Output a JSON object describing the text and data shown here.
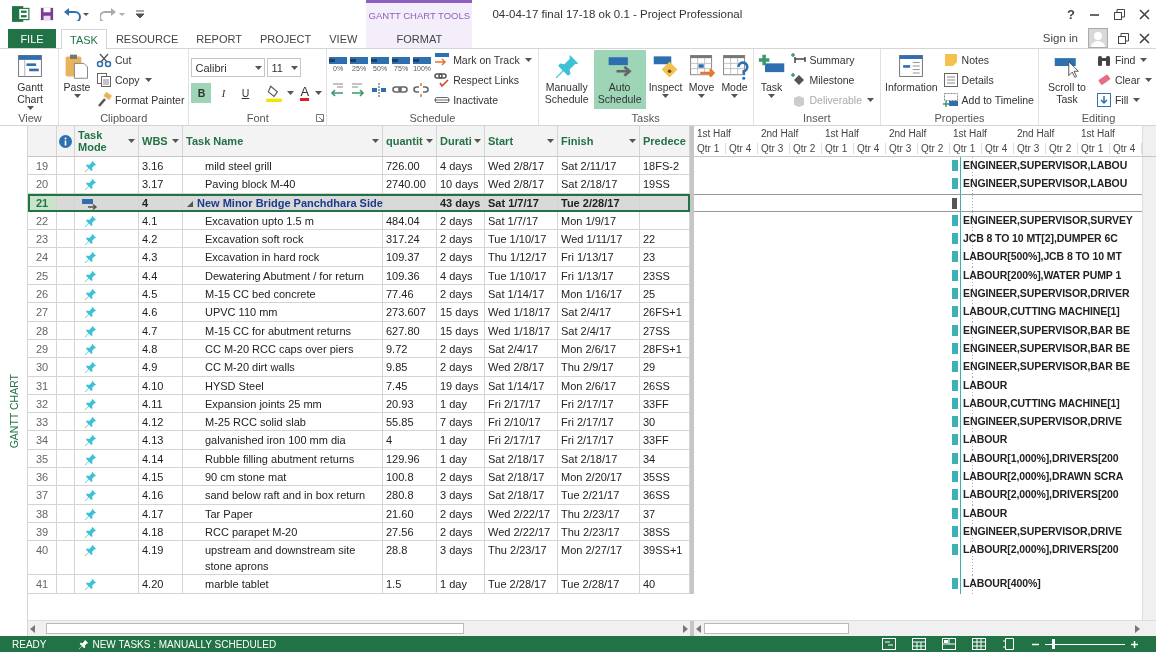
{
  "title_bar": {
    "title": "04-04-17 final 17-18 ok 0.1 - Project Professional",
    "contextual_group": "GANTT CHART TOOLS",
    "help": "?"
  },
  "ribbon_tabs": [
    {
      "label": "FILE",
      "kind": "file",
      "selected": false
    },
    {
      "label": "TASK",
      "kind": "normal",
      "selected": true
    },
    {
      "label": "RESOURCE",
      "kind": "normal",
      "selected": false
    },
    {
      "label": "REPORT",
      "kind": "normal",
      "selected": false
    },
    {
      "label": "PROJECT",
      "kind": "normal",
      "selected": false
    },
    {
      "label": "VIEW",
      "kind": "normal",
      "selected": false
    },
    {
      "label": "FORMAT",
      "kind": "contextual",
      "selected": false
    }
  ],
  "account": {
    "sign_in": "Sign in"
  },
  "ribbon": {
    "groups": [
      {
        "kind": "buttons",
        "label": "View",
        "items": [
          {
            "label": "Gantt Chart",
            "kind": "large",
            "dropdown": true,
            "selected": false,
            "disabled": false
          }
        ]
      },
      {
        "kind": "buttons",
        "label": "Clipboard",
        "items": [
          {
            "label": "Paste",
            "kind": "large",
            "dropdown": true,
            "selected": false,
            "disabled": false
          },
          {
            "label": "Cut",
            "kind": "small",
            "dropdown": false,
            "selected": false,
            "disabled": false
          },
          {
            "label": "Copy",
            "kind": "small",
            "dropdown": true,
            "selected": false,
            "disabled": false
          },
          {
            "label": "Format Painter",
            "kind": "small",
            "dropdown": false,
            "selected": false,
            "disabled": false
          }
        ]
      },
      {
        "kind": "font",
        "label": "Font",
        "font_name": "Calibri",
        "font_size": "11",
        "styles": [
          {
            "label": "B",
            "selected": true
          },
          {
            "label": "I",
            "selected": false
          },
          {
            "label": "U",
            "selected": false
          }
        ],
        "font_color": "A"
      },
      {
        "kind": "schedule",
        "label": "Schedule",
        "percent_buttons": [
          "0%",
          "25%",
          "50%",
          "75%",
          "100%"
        ],
        "items": [
          {
            "label": "Mark on Track",
            "kind": "small",
            "dropdown": true,
            "selected": false,
            "disabled": false
          },
          {
            "label": "Respect Links",
            "kind": "small",
            "dropdown": false,
            "selected": false,
            "disabled": false
          },
          {
            "label": "Inactivate",
            "kind": "small",
            "dropdown": false,
            "selected": false,
            "disabled": false
          }
        ]
      },
      {
        "kind": "buttons",
        "label": "Tasks",
        "items": [
          {
            "label": "Manually Schedule",
            "kind": "large",
            "dropdown": false,
            "selected": false,
            "disabled": false
          },
          {
            "label": "Auto Schedule",
            "kind": "large",
            "dropdown": false,
            "selected": true,
            "disabled": false
          },
          {
            "label": "Inspect",
            "kind": "large",
            "dropdown": true,
            "selected": false,
            "disabled": false
          },
          {
            "label": "Move",
            "kind": "large",
            "dropdown": true,
            "selected": false,
            "disabled": false
          },
          {
            "label": "Mode",
            "kind": "large",
            "dropdown": true,
            "selected": false,
            "disabled": false
          }
        ]
      },
      {
        "kind": "buttons",
        "label": "Insert",
        "items": [
          {
            "label": "Task",
            "kind": "large",
            "dropdown": true,
            "selected": false,
            "disabled": false
          },
          {
            "label": "Summary",
            "kind": "small",
            "dropdown": false,
            "selected": false,
            "disabled": false
          },
          {
            "label": "Milestone",
            "kind": "small",
            "dropdown": false,
            "selected": false,
            "disabled": false
          },
          {
            "label": "Deliverable",
            "kind": "small",
            "dropdown": true,
            "selected": false,
            "disabled": true
          }
        ]
      },
      {
        "kind": "buttons",
        "label": "Properties",
        "items": [
          {
            "label": "Information",
            "kind": "large",
            "dropdown": false,
            "selected": false,
            "disabled": false
          },
          {
            "label": "Notes",
            "kind": "small",
            "dropdown": false,
            "selected": false,
            "disabled": false
          },
          {
            "label": "Details",
            "kind": "small",
            "dropdown": false,
            "selected": false,
            "disabled": false
          },
          {
            "label": "Add to Timeline",
            "kind": "small",
            "dropdown": false,
            "selected": false,
            "disabled": false
          }
        ]
      },
      {
        "kind": "buttons",
        "label": "Editing",
        "items": [
          {
            "label": "Scroll to Task",
            "kind": "large",
            "dropdown": false,
            "selected": false,
            "disabled": false
          },
          {
            "label": "Find",
            "kind": "small",
            "dropdown": true,
            "selected": false,
            "disabled": false
          },
          {
            "label": "Clear",
            "kind": "small",
            "dropdown": true,
            "selected": false,
            "disabled": false
          },
          {
            "label": "Fill",
            "kind": "small",
            "dropdown": true,
            "selected": false,
            "disabled": false
          }
        ]
      }
    ]
  },
  "view_label": "GANTT CHART",
  "table": {
    "columns": [
      {
        "label": "Task Mode",
        "dropdown": true
      },
      {
        "label": "WBS",
        "dropdown": true
      },
      {
        "label": "Task Name",
        "dropdown": true
      },
      {
        "label": "quantit",
        "dropdown": true
      },
      {
        "label": "Durati",
        "dropdown": true
      },
      {
        "label": "Start",
        "dropdown": true
      },
      {
        "label": "Finish",
        "dropdown": true
      },
      {
        "label": "Predece",
        "dropdown": false
      }
    ],
    "rows": [
      {
        "id": "19",
        "kind": "task",
        "manually_scheduled": true,
        "wbs": "3.16",
        "name": "mild steel grill",
        "quantity": "726.00",
        "duration": "4 days",
        "start": "Wed 2/8/17",
        "finish": "Sat 2/11/17",
        "predecessors": "18FS-2",
        "resources": "ENGINEER,SUPERVISOR,LABOU",
        "selected": false
      },
      {
        "id": "20",
        "kind": "task",
        "manually_scheduled": true,
        "wbs": "3.17",
        "name": "Paving block M-40",
        "quantity": "2740.00",
        "duration": "10 days",
        "start": "Wed 2/8/17",
        "finish": "Sat 2/18/17",
        "predecessors": "19SS",
        "resources": "ENGINEER,SUPERVISOR,LABOU",
        "selected": false
      },
      {
        "id": "21",
        "kind": "summary",
        "manually_scheduled": false,
        "wbs": "4",
        "name": "New Minor Bridge Panchdhara Side",
        "duration": "43 days",
        "start": "Sat 1/7/17",
        "finish": "Tue 2/28/17",
        "selected": true
      },
      {
        "id": "22",
        "kind": "task",
        "manually_scheduled": true,
        "wbs": "4.1",
        "name": "Excavation upto 1.5 m",
        "quantity": "484.04",
        "duration": "2 days",
        "start": "Sat 1/7/17",
        "finish": "Mon 1/9/17",
        "resources": "ENGINEER,SUPERVISOR,SURVEY",
        "selected": false
      },
      {
        "id": "23",
        "kind": "task",
        "manually_scheduled": true,
        "wbs": "4.2",
        "name": "Excavation soft rock",
        "quantity": "317.24",
        "duration": "2 days",
        "start": "Tue 1/10/17",
        "finish": "Wed 1/11/17",
        "predecessors": "22",
        "resources": "JCB 8 TO 10 MT[2],DUMPER 6C",
        "selected": false
      },
      {
        "id": "24",
        "kind": "task",
        "manually_scheduled": true,
        "wbs": "4.3",
        "name": "Excavation in hard rock",
        "quantity": "109.37",
        "duration": "2 days",
        "start": "Thu 1/12/17",
        "finish": "Fri 1/13/17",
        "predecessors": "23",
        "resources": "LABOUR[500%],JCB 8 TO 10 MT",
        "selected": false
      },
      {
        "id": "25",
        "kind": "task",
        "manually_scheduled": true,
        "wbs": "4.4",
        "name": "Dewatering Abutment / for return",
        "quantity": "109.36",
        "duration": "4 days",
        "start": "Tue 1/10/17",
        "finish": "Fri 1/13/17",
        "predecessors": "23SS",
        "resources": "LABOUR[200%],WATER PUMP 1",
        "selected": false
      },
      {
        "id": "26",
        "kind": "task",
        "manually_scheduled": true,
        "wbs": "4.5",
        "name": "M-15 CC bed concrete",
        "quantity": "77.46",
        "duration": "2 days",
        "start": "Sat 1/14/17",
        "finish": "Mon 1/16/17",
        "predecessors": "25",
        "resources": "ENGINEER,SUPERVISOR,DRIVER",
        "selected": false
      },
      {
        "id": "27",
        "kind": "task",
        "manually_scheduled": true,
        "wbs": "4.6",
        "name": "UPVC 110 mm",
        "quantity": "273.607",
        "duration": "15 days",
        "start": "Wed 1/18/17",
        "finish": "Sat 2/4/17",
        "predecessors": "26FS+1",
        "resources": "LABOUR,CUTTING MACHINE[1]",
        "selected": false
      },
      {
        "id": "28",
        "kind": "task",
        "manually_scheduled": true,
        "wbs": "4.7",
        "name": "M-15 CC for abutment returns",
        "quantity": "627.80",
        "duration": "15 days",
        "start": "Wed 1/18/17",
        "finish": "Sat 2/4/17",
        "predecessors": "27SS",
        "resources": "ENGINEER,SUPERVISOR,BAR BE",
        "selected": false
      },
      {
        "id": "29",
        "kind": "task",
        "manually_scheduled": true,
        "wbs": "4.8",
        "name": "CC M-20 RCC caps over piers",
        "quantity": "9.72",
        "duration": "2 days",
        "start": "Sat 2/4/17",
        "finish": "Mon 2/6/17",
        "predecessors": "28FS+1",
        "resources": "ENGINEER,SUPERVISOR,BAR BE",
        "selected": false
      },
      {
        "id": "30",
        "kind": "task",
        "manually_scheduled": true,
        "wbs": "4.9",
        "name": "CC M-20 dirt walls",
        "quantity": "9.85",
        "duration": "2 days",
        "start": "Wed 2/8/17",
        "finish": "Thu 2/9/17",
        "predecessors": "29",
        "resources": "ENGINEER,SUPERVISOR,BAR BE",
        "selected": false
      },
      {
        "id": "31",
        "kind": "task",
        "manually_scheduled": true,
        "wbs": "4.10",
        "name": "HYSD Steel",
        "quantity": "7.45",
        "duration": "19 days",
        "start": "Sat 1/14/17",
        "finish": "Mon 2/6/17",
        "predecessors": "26SS",
        "resources": "LABOUR",
        "selected": false
      },
      {
        "id": "32",
        "kind": "task",
        "manually_scheduled": true,
        "wbs": "4.11",
        "name": "Expansion joints 25 mm",
        "quantity": "20.93",
        "duration": "1 day",
        "start": "Fri 2/17/17",
        "finish": "Fri 2/17/17",
        "predecessors": "33FF",
        "resources": "LABOUR,CUTTING MACHINE[1]",
        "selected": false
      },
      {
        "id": "33",
        "kind": "task",
        "manually_scheduled": true,
        "wbs": "4.12",
        "name": "M-25 RCC solid slab",
        "quantity": "55.85",
        "duration": "7 days",
        "start": "Fri 2/10/17",
        "finish": "Fri 2/17/17",
        "predecessors": "30",
        "resources": "ENGINEER,SUPERVISOR,DRIVE",
        "selected": false
      },
      {
        "id": "34",
        "kind": "task",
        "manually_scheduled": true,
        "wbs": "4.13",
        "name": "galvanished iron 100 mm dia",
        "quantity": "4",
        "duration": "1 day",
        "start": "Fri 2/17/17",
        "finish": "Fri 2/17/17",
        "predecessors": "33FF",
        "resources": "LABOUR",
        "selected": false
      },
      {
        "id": "35",
        "kind": "task",
        "manually_scheduled": true,
        "wbs": "4.14",
        "name": "Rubble filling abutment returns",
        "quantity": "129.96",
        "duration": "1 day",
        "start": "Sat 2/18/17",
        "finish": "Sat 2/18/17",
        "predecessors": "34",
        "resources": "LABOUR[1,000%],DRIVERS[200",
        "selected": false
      },
      {
        "id": "36",
        "kind": "task",
        "manually_scheduled": true,
        "wbs": "4.15",
        "name": "90 cm stone mat",
        "quantity": "100.8",
        "duration": "2 days",
        "start": "Sat 2/18/17",
        "finish": "Mon 2/20/17",
        "predecessors": "35SS",
        "resources": "LABOUR[2,000%],DRAWN SCRA",
        "selected": false
      },
      {
        "id": "37",
        "kind": "task",
        "manually_scheduled": true,
        "wbs": "4.16",
        "name": "sand below raft and in box return",
        "quantity": "280.8",
        "duration": "3 days",
        "start": "Sat 2/18/17",
        "finish": "Tue 2/21/17",
        "predecessors": "36SS",
        "resources": "LABOUR[2,000%],DRIVERS[200",
        "selected": false
      },
      {
        "id": "38",
        "kind": "task",
        "manually_scheduled": true,
        "wbs": "4.17",
        "name": "Tar Paper",
        "quantity": "21.60",
        "duration": "2 days",
        "start": "Wed 2/22/17",
        "finish": "Thu 2/23/17",
        "predecessors": "37",
        "resources": "LABOUR",
        "selected": false
      },
      {
        "id": "39",
        "kind": "task",
        "manually_scheduled": true,
        "wbs": "4.18",
        "name": "RCC parapet M-20",
        "quantity": "27.56",
        "duration": "2 days",
        "start": "Wed 2/22/17",
        "finish": "Thu 2/23/17",
        "predecessors": "38SS",
        "resources": "ENGINEER,SUPERVISOR,DRIVE",
        "selected": false
      },
      {
        "id": "40",
        "kind": "task",
        "manually_scheduled": true,
        "wbs": "4.19",
        "name": "upstream and downstream site stone aprons",
        "quantity": "28.8",
        "duration": "3 days",
        "start": "Thu 2/23/17",
        "finish": "Mon 2/27/17",
        "predecessors": "39SS+1",
        "resources": "LABOUR[2,000%],DRIVERS[200",
        "selected": false
      },
      {
        "id": "41",
        "kind": "task",
        "manually_scheduled": true,
        "wbs": "4.20",
        "name": "marble tablet",
        "quantity": "1.5",
        "duration": "1 day",
        "start": "Tue 2/28/17",
        "finish": "Tue 2/28/17",
        "predecessors": "40",
        "resources": "LABOUR[400%]",
        "selected": false
      }
    ]
  },
  "timescale": {
    "halves": [
      "1st Half",
      "2nd Half",
      "1st Half",
      "2nd Half",
      "1st Half",
      "2nd Half",
      "1st Half"
    ],
    "quarters": [
      "Qtr 1",
      "Qtr 4",
      "Qtr 3",
      "Qtr 2",
      "Qtr 1",
      "Qtr 4",
      "Qtr 3",
      "Qtr 2",
      "Qtr 1",
      "Qtr 4",
      "Qtr 3",
      "Qtr 2",
      "Qtr 1",
      "Qtr 4"
    ]
  },
  "status_bar": {
    "ready": "READY",
    "new_tasks": "NEW TASKS : MANUALLY SCHEDULED",
    "zoom": {
      "level": 0.1
    }
  }
}
